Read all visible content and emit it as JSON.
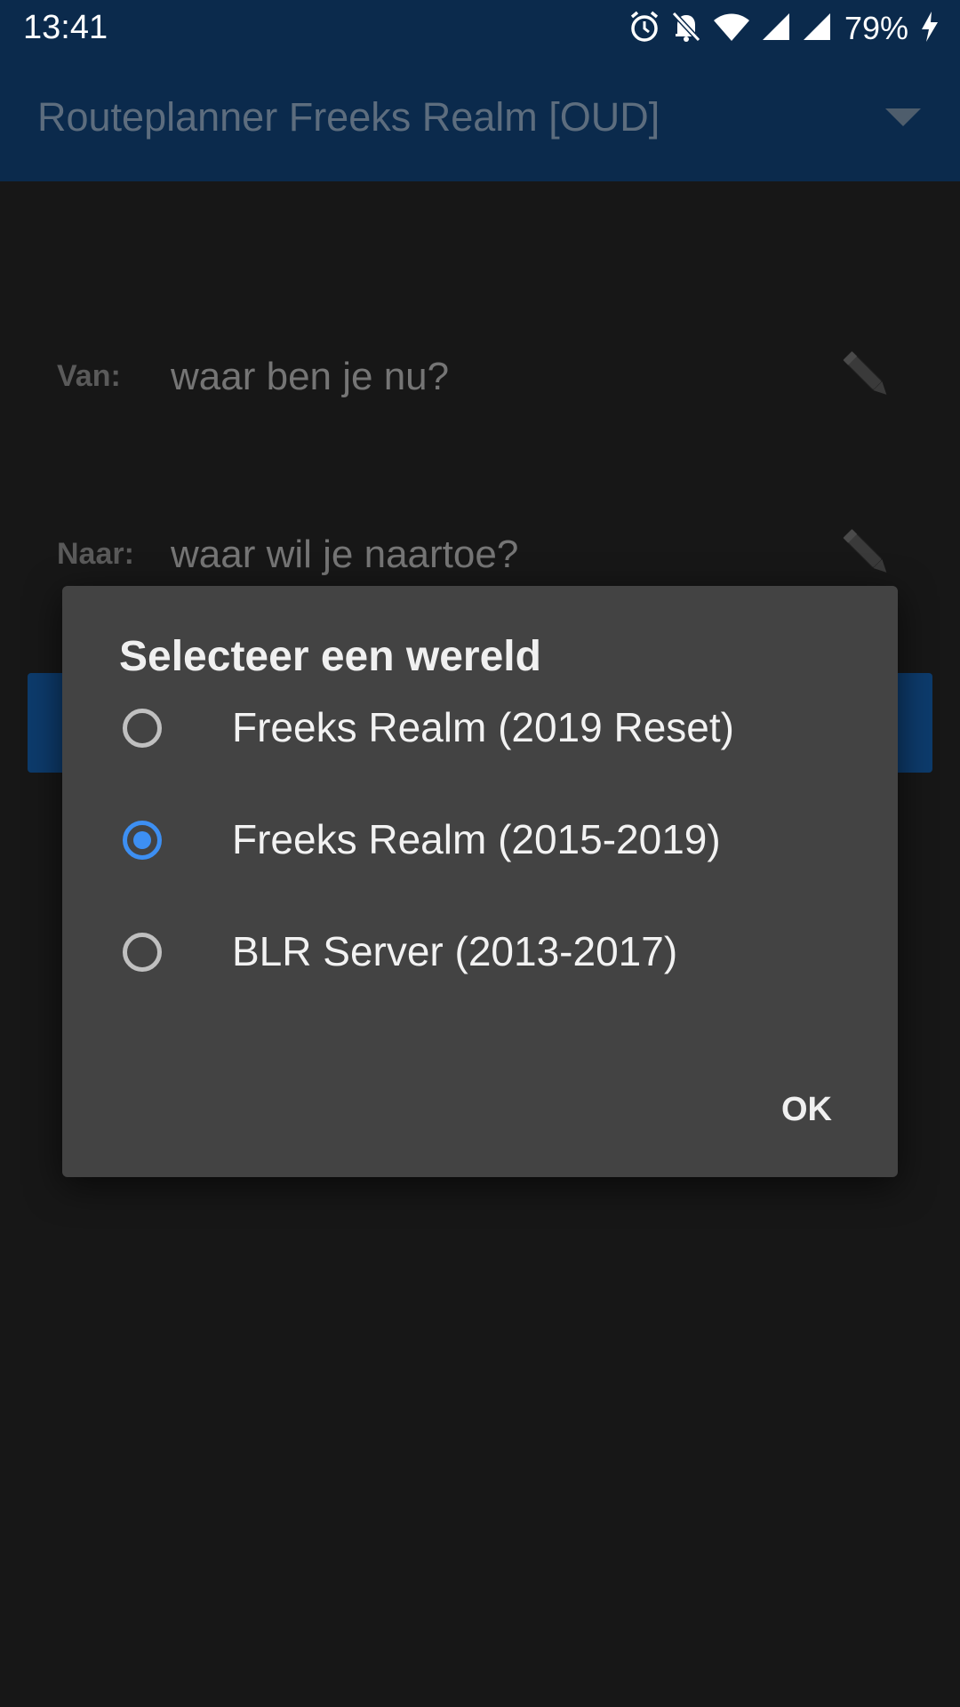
{
  "status_bar": {
    "time": "13:41",
    "battery": "79%",
    "icons": [
      "alarm-icon",
      "notifications-off-icon",
      "wifi-icon",
      "signal-icon",
      "signal-icon",
      "charging-icon"
    ]
  },
  "app_bar": {
    "title": "Routeplanner Freeks Realm [OUD]",
    "dropdown_icon": "dropdown-arrow-icon"
  },
  "form": {
    "from_label": "Van:",
    "from_placeholder": "waar ben je nu?",
    "to_label": "Naar:",
    "to_placeholder": "waar wil je naartoe?",
    "edit_icon": "pencil-icon"
  },
  "dialog": {
    "title": "Selecteer een wereld",
    "options": [
      {
        "label": "Freeks Realm (2019 Reset)",
        "selected": false
      },
      {
        "label": "Freeks Realm (2015-2019)",
        "selected": true
      },
      {
        "label": "BLR Server (2013-2017)",
        "selected": false
      }
    ],
    "ok_label": "OK"
  },
  "colors": {
    "accent": "#3d8ff2",
    "app_bar": "#0b2a4c",
    "dialog_bg": "#434343",
    "screen_bg": "#171717"
  }
}
